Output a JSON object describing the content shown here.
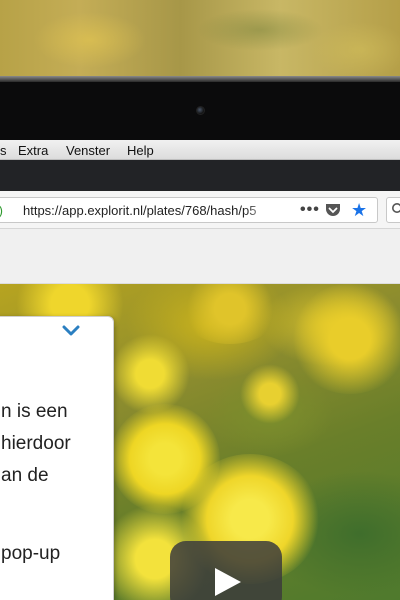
{
  "menubar": {
    "items": [
      "s",
      "Extra",
      "Venster",
      "Help"
    ]
  },
  "address_bar": {
    "prefix": ".)",
    "url": "https://app.explorit.nl/plates/768/hash/p5"
  },
  "toolbar": {
    "more_glyph": "•••"
  },
  "popup": {
    "lines": [
      "n is een",
      "hierdoor",
      "an de",
      "pop-up"
    ]
  },
  "colors": {
    "accent": "#1a73e8",
    "chevron": "#2b7fc1",
    "secure_green": "#2e9a2e"
  }
}
